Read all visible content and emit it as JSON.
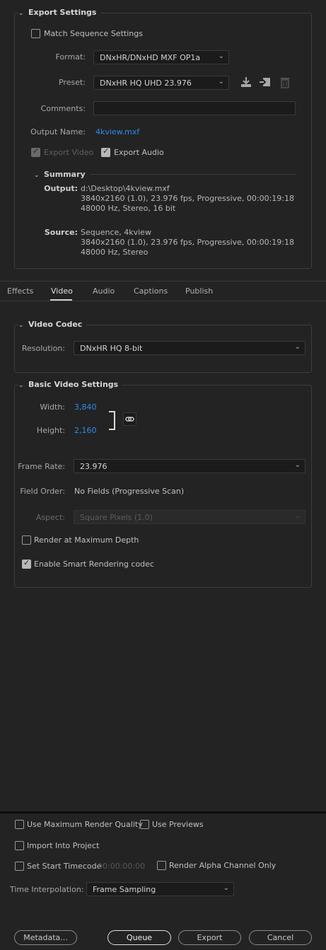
{
  "export_settings": {
    "title": "Export Settings",
    "match_sequence": {
      "label": "Match Sequence Settings",
      "checked": false
    },
    "format": {
      "label": "Format:",
      "value": "DNxHR/DNxHD MXF OP1a"
    },
    "preset": {
      "label": "Preset:",
      "value": "DNxHR HQ UHD 23.976"
    },
    "comments": {
      "label": "Comments:",
      "value": ""
    },
    "output_name": {
      "label": "Output Name:",
      "value": "4kview.mxf"
    },
    "export_video": {
      "label": "Export Video",
      "checked": true,
      "disabled": true
    },
    "export_audio": {
      "label": "Export Audio",
      "checked": true
    },
    "summary": {
      "title": "Summary",
      "output_key": "Output:",
      "output_lines": [
        "d:\\Desktop\\4kview.mxf",
        "3840x2160 (1.0), 23.976 fps, Progressive, 00:00:19:18",
        "48000 Hz, Stereo, 16 bit"
      ],
      "source_key": "Source:",
      "source_lines": [
        "Sequence, 4kview",
        "3840x2160 (1.0), 23.976 fps, Progressive, 00:00:19:18",
        "48000 Hz, Stereo"
      ]
    }
  },
  "tabs": [
    "Effects",
    "Video",
    "Audio",
    "Captions",
    "Publish"
  ],
  "active_tab": "Video",
  "video_codec": {
    "title": "Video Codec",
    "resolution": {
      "label": "Resolution:",
      "value": "DNxHR HQ 8-bit"
    }
  },
  "basic_video": {
    "title": "Basic Video Settings",
    "width": {
      "label": "Width:",
      "value": "3,840"
    },
    "height": {
      "label": "Height:",
      "value": "2,160"
    },
    "frame_rate": {
      "label": "Frame Rate:",
      "value": "23.976"
    },
    "field_order": {
      "label": "Field Order:",
      "value": "No Fields (Progressive Scan)"
    },
    "aspect": {
      "label": "Aspect:",
      "value": "Square Pixels (1.0)"
    },
    "render_max_depth": {
      "label": "Render at Maximum Depth",
      "checked": false
    },
    "smart_rendering": {
      "label": "Enable Smart Rendering codec",
      "checked": true
    }
  },
  "bottom": {
    "max_render_quality": {
      "label": "Use Maximum Render Quality",
      "checked": false
    },
    "use_previews": {
      "label": "Use Previews",
      "checked": false
    },
    "import_project": {
      "label": "Import Into Project",
      "checked": false
    },
    "start_timecode": {
      "label": "Set Start Timecode",
      "checked": false,
      "value": "00:00:00:00"
    },
    "alpha_only": {
      "label": "Render Alpha Channel Only",
      "checked": false
    },
    "time_interp": {
      "label": "Time Interpolation:",
      "value": "Frame Sampling"
    }
  },
  "buttons": {
    "metadata": "Metadata...",
    "queue": "Queue",
    "export": "Export",
    "cancel": "Cancel"
  },
  "icons": {
    "save_preset": "download-icon",
    "import_preset": "import-icon",
    "delete_preset": "trash-icon",
    "link": "link-chain-icon"
  }
}
